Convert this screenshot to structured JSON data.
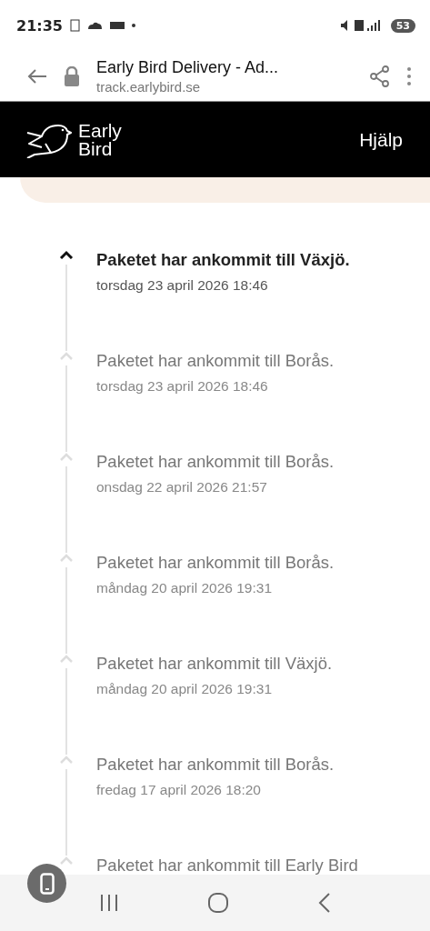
{
  "status_bar": {
    "time": "21:35",
    "battery": "53"
  },
  "browser": {
    "title": "Early Bird Delivery - Ad...",
    "url": "track.earlybird.se"
  },
  "header": {
    "logo_line_1": "Early",
    "logo_line_2": "Bird",
    "help": "Hjälp"
  },
  "events": [
    {
      "title": "Paketet har ankommit till Växjö.",
      "date": "torsdag 23 april 2026 18:46",
      "current": true
    },
    {
      "title": "Paketet har ankommit till Borås.",
      "date": "torsdag 23 april 2026 18:46",
      "current": false
    },
    {
      "title": "Paketet har ankommit till Borås.",
      "date": "onsdag 22 april 2026 21:57",
      "current": false
    },
    {
      "title": "Paketet har ankommit till Borås.",
      "date": "måndag 20 april 2026 19:31",
      "current": false
    },
    {
      "title": "Paketet har ankommit till Växjö.",
      "date": "måndag 20 april 2026 19:31",
      "current": false
    },
    {
      "title": "Paketet har ankommit till Borås.",
      "date": "fredag 17 april 2026 18:20",
      "current": false
    },
    {
      "title": "Paketet har ankommit till Early Bird",
      "current": false
    }
  ]
}
